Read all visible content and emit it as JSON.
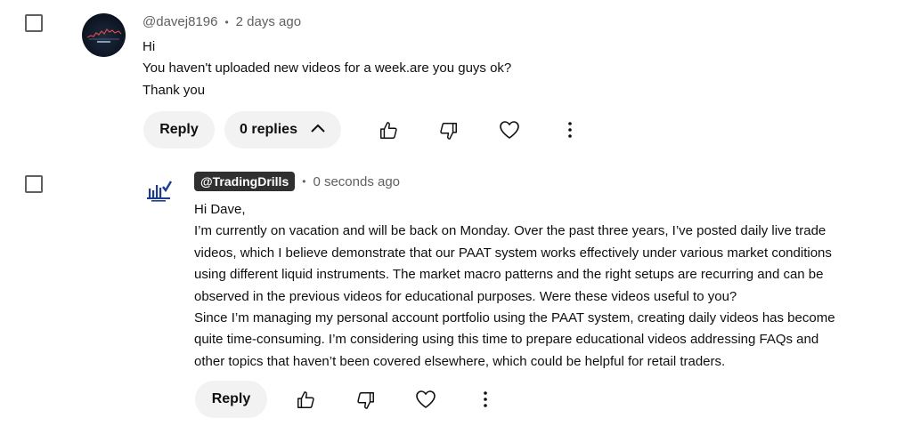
{
  "comment": {
    "author": "@davej8196",
    "time": "2 days ago",
    "lines": [
      "Hi",
      "You haven't uploaded new videos for a week.are you guys ok?",
      "Thank you"
    ],
    "actions": {
      "reply_label": "Reply",
      "replies_label": "0 replies"
    }
  },
  "reply": {
    "author": "@TradingDrills",
    "time": "0 seconds ago",
    "lines": [
      "Hi Dave,",
      "I’m currently on vacation and will be back on Monday. Over the past three years, I’ve posted daily live trade",
      "videos, which I believe demonstrate that our PAAT system works effectively under various market conditions",
      "using different liquid instruments. The market macro patterns and the right setups are recurring and can be",
      "observed in the previous videos for educational purposes. Were these videos useful to you?",
      "Since I’m managing my personal account portfolio using the PAAT system, creating daily videos has become",
      "quite time-consuming. I’m considering using this time to prepare educational videos addressing FAQs and",
      "other topics that haven’t been covered elsewhere, which could be helpful for retail traders."
    ],
    "actions": {
      "reply_label": "Reply"
    }
  },
  "meta_separator": "•",
  "icons": {
    "like": "thumbs-up-icon",
    "dislike": "thumbs-down-icon",
    "heart": "heart-icon",
    "more": "more-vertical-icon",
    "chevron": "chevron-up-icon",
    "channel_logo": "chart-bars-icon"
  },
  "colors": {
    "text": "#0f0f0f",
    "meta": "#606060",
    "pill_bg": "#f2f2f2",
    "badge_bg": "#303030",
    "logo": "#1d3c8f"
  }
}
